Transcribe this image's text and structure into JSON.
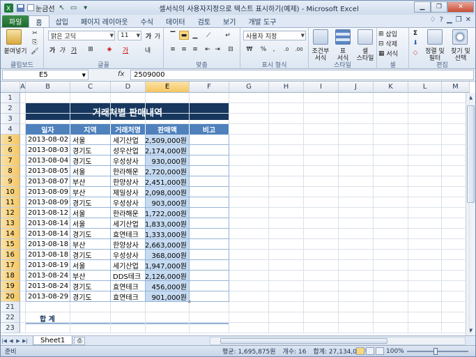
{
  "window": {
    "title": "셀서식의 사용자지정으로 텍스트 표시하기(예제) - Microsoft Excel",
    "qat_gridlines_label": "눈금선"
  },
  "tabs": [
    {
      "label": "파일"
    },
    {
      "label": "홈"
    },
    {
      "label": "삽입"
    },
    {
      "label": "페이지 레이아웃"
    },
    {
      "label": "수식"
    },
    {
      "label": "데이터"
    },
    {
      "label": "검토"
    },
    {
      "label": "보기"
    },
    {
      "label": "개발 도구"
    }
  ],
  "ribbon": {
    "clipboard": {
      "paste": "붙여넣기",
      "label": "클립보드"
    },
    "font": {
      "name": "맑은 고딕",
      "size": "11",
      "label": "글꼴"
    },
    "align": {
      "label": "맞춤"
    },
    "number": {
      "format": "사용자 지정",
      "label": "표시 형식"
    },
    "styles": {
      "cond": "조건부",
      "cond2": "서식",
      "table": "표",
      "table2": "서식",
      "cell": "셀",
      "cell2": "스타일",
      "label": "스타일"
    },
    "cells": {
      "insert": "삽입",
      "delete": "삭제",
      "format": "서식",
      "label": "셀"
    },
    "editing": {
      "sort": "정렬 및",
      "sort2": "필터",
      "find": "찾기 및",
      "find2": "선택",
      "label": "편집"
    }
  },
  "formula_bar": {
    "name_box": "E5",
    "fx": "fx",
    "value": "2509000"
  },
  "columns": [
    "A",
    "B",
    "C",
    "D",
    "E",
    "F",
    "G",
    "H",
    "I",
    "J",
    "K",
    "L",
    "M"
  ],
  "rows": [
    "1",
    "2",
    "3",
    "4",
    "5",
    "6",
    "7",
    "8",
    "9",
    "10",
    "11",
    "12",
    "13",
    "14",
    "15",
    "16",
    "17",
    "18",
    "19",
    "20",
    "21",
    "22",
    "23"
  ],
  "sheet": {
    "banner_title": "거래처별 판매내역",
    "headers": [
      "일자",
      "지역",
      "거래처명",
      "판매액",
      "비고"
    ],
    "records": [
      {
        "date": "2013-08-02",
        "region": "서울",
        "client": "세기산업",
        "amount": "2,509,000원"
      },
      {
        "date": "2013-08-03",
        "region": "경기도",
        "client": "성우산업",
        "amount": "2,174,000원"
      },
      {
        "date": "2013-08-04",
        "region": "경기도",
        "client": "우성상사",
        "amount": "930,000원"
      },
      {
        "date": "2013-08-05",
        "region": "서울",
        "client": "한라해운",
        "amount": "2,720,000원"
      },
      {
        "date": "2013-08-07",
        "region": "부산",
        "client": "한양상사",
        "amount": "2,451,000원"
      },
      {
        "date": "2013-08-09",
        "region": "부산",
        "client": "제일상사",
        "amount": "2,098,000원"
      },
      {
        "date": "2013-08-09",
        "region": "경기도",
        "client": "우성상사",
        "amount": "903,000원"
      },
      {
        "date": "2013-08-12",
        "region": "서울",
        "client": "한라해운",
        "amount": "1,722,000원"
      },
      {
        "date": "2013-08-14",
        "region": "서울",
        "client": "세기산업",
        "amount": "1,833,000원"
      },
      {
        "date": "2013-08-14",
        "region": "경기도",
        "client": "효연테크",
        "amount": "1,333,000원"
      },
      {
        "date": "2013-08-18",
        "region": "부산",
        "client": "한양상사",
        "amount": "2,663,000원"
      },
      {
        "date": "2013-08-18",
        "region": "경기도",
        "client": "우성상사",
        "amount": "368,000원"
      },
      {
        "date": "2013-08-19",
        "region": "서울",
        "client": "세기산업",
        "amount": "1,947,000원"
      },
      {
        "date": "2013-08-24",
        "region": "부산",
        "client": "DDS테크",
        "amount": "2,126,000원"
      },
      {
        "date": "2013-08-24",
        "region": "경기도",
        "client": "효연테크",
        "amount": "456,000원"
      },
      {
        "date": "2013-08-29",
        "region": "경기도",
        "client": "효연테크",
        "amount": "901,000원"
      }
    ],
    "total_label": "합  계"
  },
  "sheet_tabs": [
    {
      "label": "Sheet1"
    }
  ],
  "status": {
    "ready": "준비",
    "average": "평균: 1,695,875원",
    "count": "개수: 16",
    "sum": "합계: 27,134,000원",
    "zoom": "100%"
  }
}
